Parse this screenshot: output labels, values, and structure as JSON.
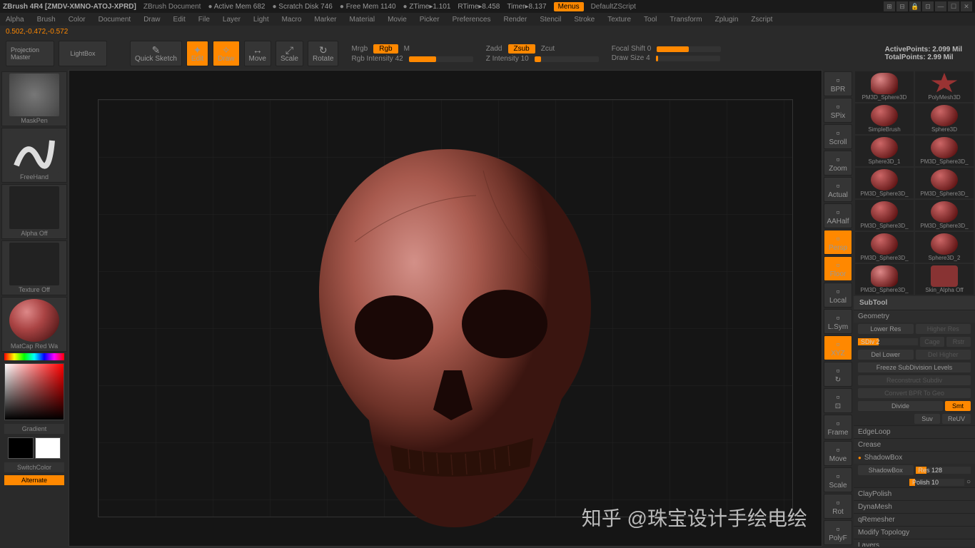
{
  "titlebar": {
    "app": "ZBrush 4R4 [ZMDV-XMNO-ATOJ-XPRD]",
    "doc": "ZBrush Document",
    "stats": {
      "active_mem": "Active Mem 682",
      "scratch": "Scratch Disk 746",
      "free_mem": "Free Mem 1140",
      "ztime": "ZTime▸1.101",
      "rtime": "RTime▸8.458",
      "timer": "Timer▸8.137"
    },
    "menus": "Menus",
    "dzs": "DefaultZScript"
  },
  "menubar": [
    "Alpha",
    "Brush",
    "Color",
    "Document",
    "Draw",
    "Edit",
    "File",
    "Layer",
    "Light",
    "Macro",
    "Marker",
    "Material",
    "Movie",
    "Picker",
    "Preferences",
    "Render",
    "Stencil",
    "Stroke",
    "Texture",
    "Tool",
    "Transform",
    "Zplugin",
    "Zscript"
  ],
  "coords": "0.502,-0.472,-0.572",
  "toolbar": {
    "projection": "Projection Master",
    "lightbox": "LightBox",
    "quicksketch": "Quick Sketch",
    "edit": "Edit",
    "draw": "Draw",
    "move": "Move",
    "scale": "Scale",
    "rotate": "Rotate",
    "mrgb": "Mrgb",
    "rgb": "Rgb",
    "m": "M",
    "rgb_intensity": "Rgb Intensity 42",
    "zadd": "Zadd",
    "zsub": "Zsub",
    "zcut": "Zcut",
    "z_intensity": "Z Intensity 10",
    "focal": "Focal Shift 0",
    "drawsize": "Draw Size 4",
    "activepoints": "ActivePoints: 2.099 Mil",
    "totalpoints": "TotalPoints: 2.99 Mil"
  },
  "left": {
    "brush": "MaskPen",
    "stroke": "FreeHand",
    "alpha": "Alpha Off",
    "texture": "Texture Off",
    "material": "MatCap Red Wa",
    "gradient": "Gradient",
    "switchcolor": "SwitchColor",
    "alternate": "Alternate"
  },
  "right_tools": [
    "BPR",
    "SPix",
    "Scroll",
    "Zoom",
    "Actual",
    "AAHalf",
    "Persp",
    "Floor",
    "Local",
    "L.Sym",
    "XYZ",
    "↻",
    "⊡",
    "Frame",
    "Move",
    "Scale",
    "Rot",
    "PolyF"
  ],
  "right_tools_on": [
    6,
    7,
    10
  ],
  "subtools": [
    {
      "l": "PM3D_Sphere3D",
      "t": "head"
    },
    {
      "l": "PolyMesh3D",
      "t": "star"
    },
    {
      "l": "SimpleBrush",
      "t": "sphere"
    },
    {
      "l": "Sphere3D",
      "t": "sphere"
    },
    {
      "l": "Sphere3D_1",
      "t": "sphere"
    },
    {
      "l": "PM3D_Sphere3D_",
      "t": "sphere"
    },
    {
      "l": "PM3D_Sphere3D_",
      "t": "sphere"
    },
    {
      "l": "PM3D_Sphere3D_",
      "t": "sphere"
    },
    {
      "l": "PM3D_Sphere3D_",
      "t": "sphere"
    },
    {
      "l": "PM3D_Sphere3D_",
      "t": "sphere"
    },
    {
      "l": "PM3D_Sphere3D_",
      "t": "sphere"
    },
    {
      "l": "Sphere3D_2",
      "t": "sphere"
    },
    {
      "l": "PM3D_Sphere3D_",
      "t": "head"
    },
    {
      "l": "Skin_Alpha Off",
      "t": "cube"
    }
  ],
  "panel": {
    "subtool": "SubTool",
    "geometry": "Geometry",
    "lower_res": "Lower Res",
    "higher_res": "Higher Res",
    "sdiv": "SDiv 2",
    "cage": "Cage",
    "rstr": "Rstr",
    "del_lower": "Del Lower",
    "del_higher": "Del Higher",
    "freeze": "Freeze SubDivision Levels",
    "reconstruct": "Reconstruct Subdiv",
    "convert": "Convert BPR To Geo",
    "divide": "Divide",
    "smt": "Smt",
    "suv": "Suv",
    "reuv": "ReUV",
    "edgeloop": "EdgeLoop",
    "crease": "Crease",
    "shadowbox": "ShadowBox",
    "shadowbox2": "ShadowBox",
    "res": "Res 128",
    "polish": "Polish 10",
    "claypolish": "ClayPolish",
    "dynamesh": "DynaMesh",
    "qremesher": "qRemesher",
    "modtopo": "Modify Topology",
    "layers": "Layers"
  },
  "watermark": "知乎 @珠宝设计手绘电绘"
}
